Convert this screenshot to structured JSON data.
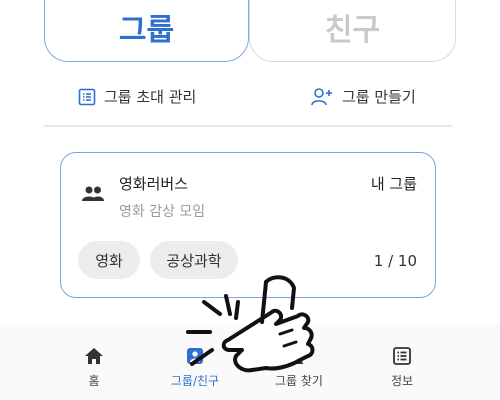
{
  "tabs": [
    {
      "label": "그룹",
      "active": true
    },
    {
      "label": "친구",
      "active": false
    }
  ],
  "actions": {
    "invite_label": "그룹 초대 관리",
    "create_label": "그룹 만들기"
  },
  "group_card": {
    "name": "영화러버스",
    "description": "영화 감상 모임",
    "badge": "내 그룹",
    "tags": [
      "영화",
      "공상과학"
    ],
    "member_count": "1 / 10"
  },
  "bottom_nav": {
    "items": [
      {
        "label": "홈",
        "icon": "home-icon"
      },
      {
        "label": "그룹/친구",
        "icon": "group-friend-icon",
        "active": true
      },
      {
        "label": "그룹 찾기",
        "icon": "find-group-icon"
      },
      {
        "label": "정보",
        "icon": "info-list-icon"
      }
    ]
  },
  "colors": {
    "accent": "#2e6fd0",
    "card_border": "#7aa6e0",
    "tag_bg": "#ececec"
  }
}
